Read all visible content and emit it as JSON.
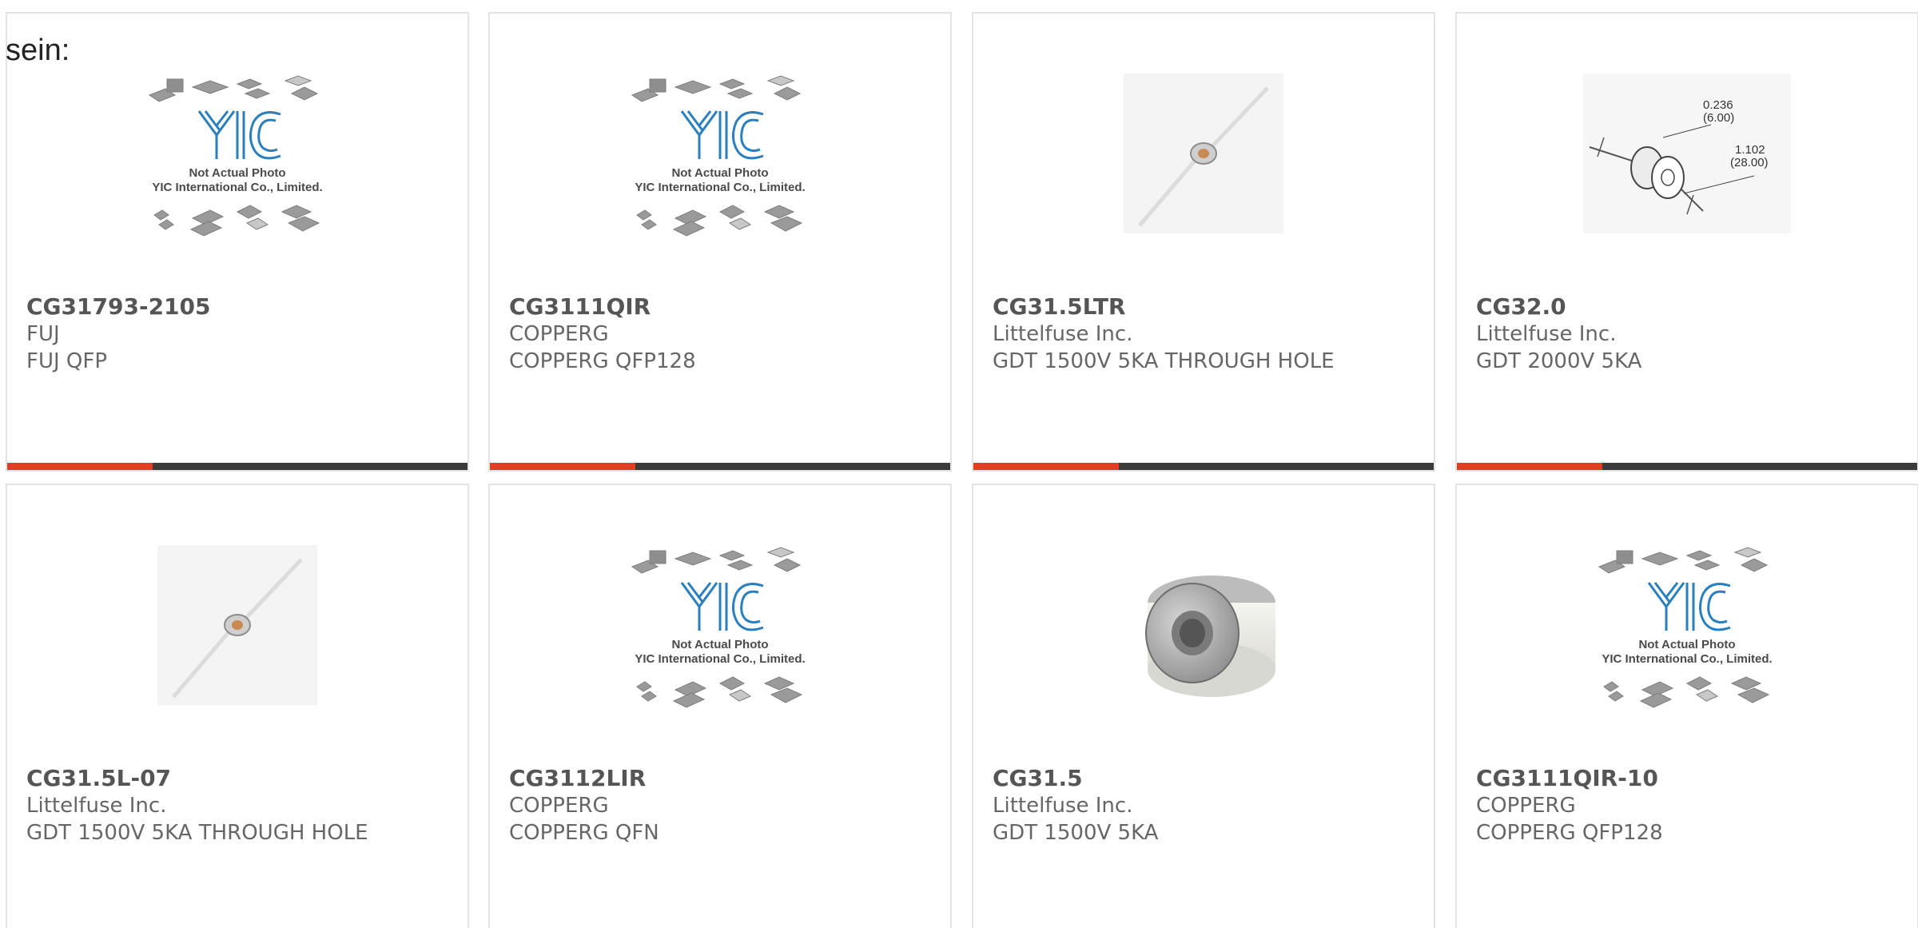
{
  "intro_text": "sein:",
  "accent_color": "#e2401a",
  "bar_color": "#3b3b3b",
  "placeholder": {
    "line1": "Not Actual Photo",
    "line2": "YIC International Co., Limited."
  },
  "dims": {
    "d1": "0.236",
    "d1mm": "(6.00)",
    "d2": "1.102",
    "d2mm": "(28.00)"
  },
  "products": [
    {
      "part": "CG31793-2105",
      "brand": "FUJ",
      "desc": "FUJ QFP",
      "image": "yic-placeholder"
    },
    {
      "part": "CG3111QIR",
      "brand": "COPPERG",
      "desc": "COPPERG QFP128",
      "image": "yic-placeholder"
    },
    {
      "part": "CG31.5LTR",
      "brand": "Littelfuse Inc.",
      "desc": "GDT 1500V 5KA THROUGH HOLE",
      "image": "gdt-axial"
    },
    {
      "part": "CG32.0",
      "brand": "Littelfuse Inc.",
      "desc": "GDT 2000V 5KA",
      "image": "gdt-dimension-drawing"
    },
    {
      "part": "CG31.5L-07",
      "brand": "Littelfuse Inc.",
      "desc": "GDT 1500V 5KA THROUGH HOLE",
      "image": "gdt-axial"
    },
    {
      "part": "CG3112LIR",
      "brand": "COPPERG",
      "desc": "COPPERG QFN",
      "image": "yic-placeholder"
    },
    {
      "part": "CG31.5",
      "brand": "Littelfuse Inc.",
      "desc": "GDT 1500V 5KA",
      "image": "gdt-ceramic"
    },
    {
      "part": "CG3111QIR-10",
      "brand": "COPPERG",
      "desc": "COPPERG QFP128",
      "image": "yic-placeholder"
    }
  ]
}
